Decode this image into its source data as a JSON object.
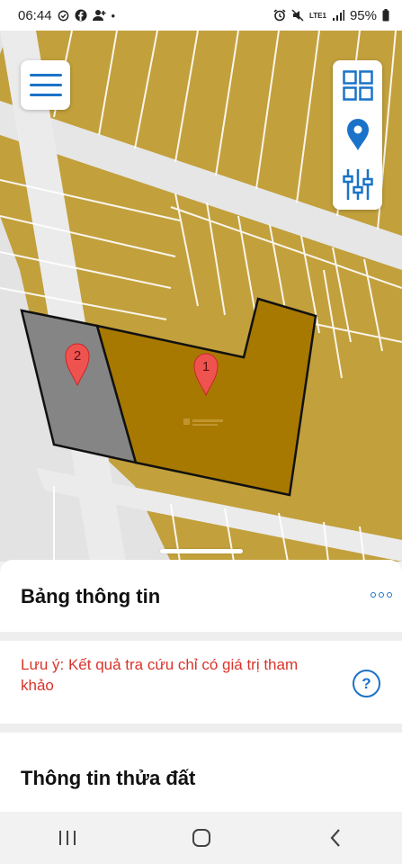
{
  "status_bar": {
    "time": "06:44",
    "left_icons": [
      "check-circle-icon",
      "facebook-icon",
      "person-add-icon"
    ],
    "dot": "•",
    "network": "LTE1",
    "battery": "95%"
  },
  "map": {
    "parcels": [
      {
        "marker": "1",
        "fill": "#a87900"
      },
      {
        "marker": "2",
        "fill": "#858585"
      }
    ],
    "colors": {
      "land": "#c2a03c",
      "road": "#e6e6e6",
      "marker": "#ef5350"
    }
  },
  "toolbar": {
    "icons": [
      "menu-icon",
      "layers-grid-icon",
      "location-pin-icon",
      "sliders-icon"
    ]
  },
  "sheet": {
    "title": "Bảng thông tin",
    "note": "Lưu ý: Kết quả tra cứu chỉ có giá trị tham khảo",
    "help_label": "?",
    "parcel_title": "Thông tin thửa đất"
  },
  "nav_bar": {
    "icons": [
      "recent-apps-icon",
      "home-icon",
      "back-icon"
    ]
  }
}
